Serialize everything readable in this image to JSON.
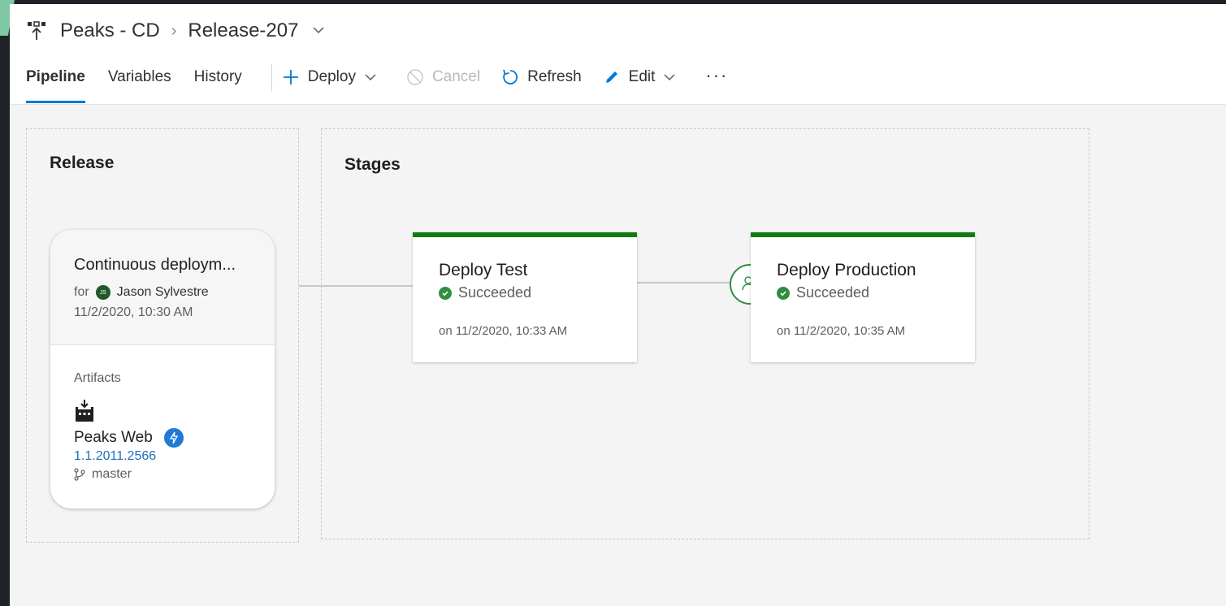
{
  "breadcrumb": {
    "pipeline": "Peaks - CD",
    "release": "Release-207"
  },
  "tabs": [
    {
      "label": "Pipeline",
      "active": true
    },
    {
      "label": "Variables",
      "active": false
    },
    {
      "label": "History",
      "active": false
    }
  ],
  "commands": {
    "deploy": "Deploy",
    "cancel": "Cancel",
    "refresh": "Refresh",
    "edit": "Edit",
    "more": "···"
  },
  "release_section": {
    "title": "Release",
    "card": {
      "title": "Continuous deploym...",
      "for_label": "for",
      "avatar_initials": "JS",
      "user": "Jason Sylvestre",
      "date": "11/2/2020, 10:30 AM",
      "artifacts_label": "Artifacts",
      "artifact_name": "Peaks Web",
      "artifact_version": "1.1.2011.2566",
      "branch": "master"
    }
  },
  "stages_section": {
    "title": "Stages",
    "stages": [
      {
        "name": "Deploy Test",
        "status": "Succeeded",
        "date": "on 11/2/2020, 10:33 AM"
      },
      {
        "name": "Deploy Production",
        "status": "Succeeded",
        "date": "on 11/2/2020, 10:35 AM"
      }
    ]
  },
  "colors": {
    "accent": "#0078d4",
    "success": "#107c10",
    "link": "#1f6fbf"
  }
}
